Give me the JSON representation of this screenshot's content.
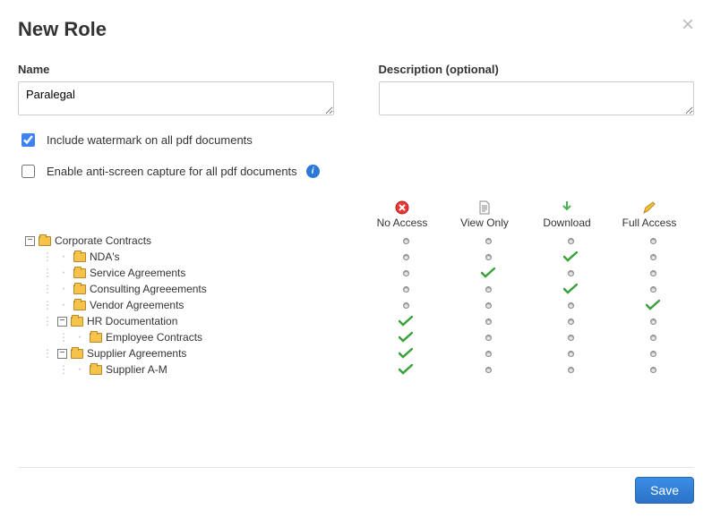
{
  "modal": {
    "title": "New Role",
    "close_label": "×"
  },
  "form": {
    "name_label": "Name",
    "name_value": "Paralegal",
    "desc_label": "Description (optional)",
    "desc_value": "",
    "watermark_label": "Include watermark on all pdf documents",
    "watermark_checked": true,
    "antiscreen_label": "Enable anti-screen capture for all pdf documents",
    "antiscreen_checked": false
  },
  "perm": {
    "headers": {
      "no_access": "No Access",
      "view_only": "View Only",
      "download": "Download",
      "full_access": "Full Access"
    },
    "rows": [
      {
        "label": "Corporate Contracts",
        "depth": 0,
        "expander": "-",
        "segColor": "seg-root",
        "segSpan": 1,
        "restColor": "seg-root-cells",
        "selected": 0
      },
      {
        "label": "NDA's",
        "depth": 1,
        "expander": "",
        "segColor": "seg-purple",
        "segSpan": 4,
        "restColor": "",
        "selected": 3
      },
      {
        "label": "Service Agreements",
        "depth": 1,
        "expander": "",
        "segColor": "seg-orange",
        "segSpan": 3,
        "restColor": "",
        "selected": 2
      },
      {
        "label": "Consulting Agreeements",
        "depth": 1,
        "expander": "",
        "segColor": "seg-purple",
        "segSpan": 4,
        "restColor": "",
        "selected": 3
      },
      {
        "label": "Vendor Agreements",
        "depth": 1,
        "expander": "",
        "segColor": "seg-green",
        "segSpan": 5,
        "restColor": "",
        "selected": 4
      },
      {
        "label": "HR Documentation",
        "depth": 1,
        "expander": "-",
        "segColor": "seg-pink",
        "segSpan": 4,
        "restColor": "seg-pink",
        "selected": 1,
        "selectedIsCheck": true
      },
      {
        "label": "Employee Contracts",
        "depth": 2,
        "expander": "",
        "segColor": "seg-pink",
        "segSpan": 4,
        "restColor": "seg-pink",
        "selected": 1,
        "selectedIsCheck": true
      },
      {
        "label": "Supplier Agreements",
        "depth": 1,
        "expander": "-",
        "segColor": "seg-pink",
        "segSpan": 4,
        "restColor": "seg-pink",
        "selected": 1,
        "selectedIsCheck": true
      },
      {
        "label": "Supplier A-M",
        "depth": 2,
        "expander": "",
        "segColor": "seg-pink",
        "segSpan": 4,
        "restColor": "seg-pink",
        "selected": 1,
        "selectedIsCheck": true
      }
    ]
  },
  "footer": {
    "save_label": "Save"
  }
}
